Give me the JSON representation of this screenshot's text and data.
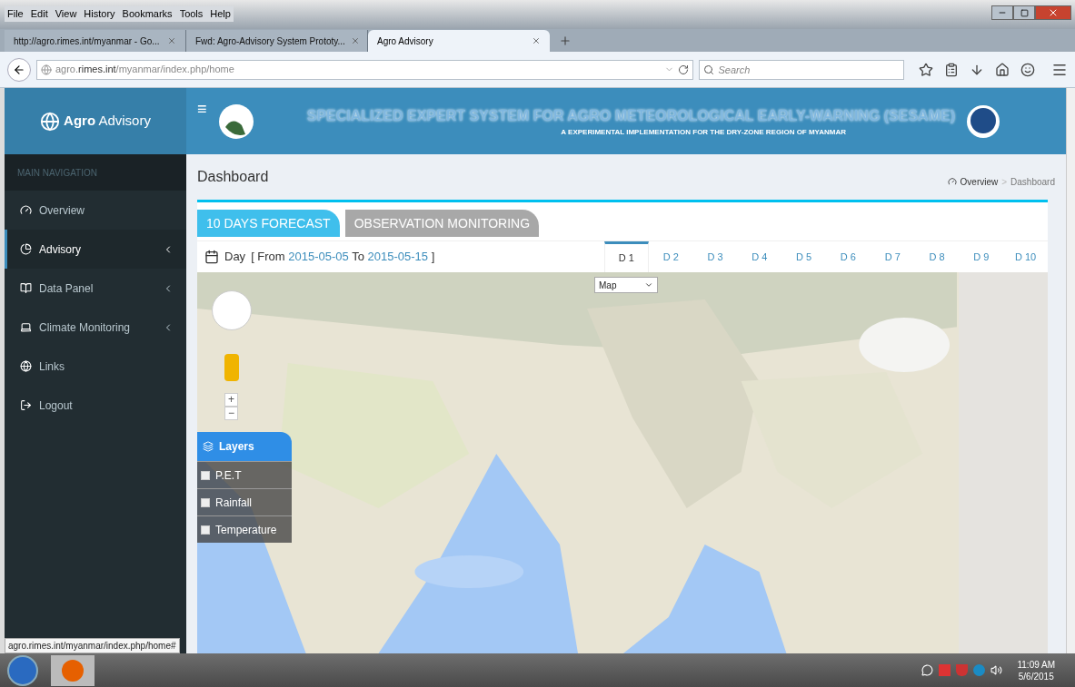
{
  "menu_bar": [
    "File",
    "Edit",
    "View",
    "History",
    "Bookmarks",
    "Tools",
    "Help"
  ],
  "browser_tabs": [
    {
      "title": "http://agro.rimes.int/myanmar - Go...",
      "selected": false
    },
    {
      "title": "Fwd: Agro-Advisory System Prototy...",
      "selected": false
    },
    {
      "title": "Agro Advisory",
      "selected": true
    }
  ],
  "address_bar": {
    "host_prefix": "agro.",
    "host": "rimes.int",
    "path": "/myanmar/index.php/home"
  },
  "search": {
    "placeholder": "Search"
  },
  "app": {
    "logo_bold": "Agro",
    "logo_text": "Advisory",
    "menu_toggle": "≡",
    "banner_title": "SPECIALIZED EXPERT SYSTEM FOR AGRO METEOROLOGICAL EARLY-WARNING (SESAME)",
    "banner_subtitle": "A EXPERIMENTAL IMPLEMENTATION FOR THE DRY-ZONE REGION OF MYANMAR"
  },
  "sidebar": {
    "heading": "MAIN NAVIGATION",
    "items": [
      {
        "label": "Overview",
        "selected": false,
        "has_submenu": false
      },
      {
        "label": "Advisory",
        "selected": true,
        "has_submenu": true
      },
      {
        "label": "Data Panel",
        "selected": false,
        "has_submenu": true
      },
      {
        "label": "Climate Monitoring",
        "selected": false,
        "has_submenu": true
      },
      {
        "label": "Links",
        "selected": false,
        "has_submenu": false
      },
      {
        "label": "Logout",
        "selected": false,
        "has_submenu": false
      }
    ]
  },
  "page_title": "Dashboard",
  "breadcrumb": [
    "Overview",
    "Dashboard"
  ],
  "breadcrumb_separator": ">",
  "section_tabs": [
    {
      "label": "10 DAYS FORECAST",
      "selected": true
    },
    {
      "label": "OBSERVATION MONITORING",
      "selected": false
    }
  ],
  "day_range": {
    "label": "Day",
    "open": "[ From",
    "from": "2015-05-05",
    "to_label": "To",
    "to": "2015-05-15",
    "close": "]"
  },
  "day_tabs": [
    {
      "label": "D 1",
      "selected": true
    },
    {
      "label": "D 2",
      "selected": false
    },
    {
      "label": "D 3",
      "selected": false
    },
    {
      "label": "D 4",
      "selected": false
    },
    {
      "label": "D 5",
      "selected": false
    },
    {
      "label": "D 6",
      "selected": false
    },
    {
      "label": "D 7",
      "selected": false
    },
    {
      "label": "D 8",
      "selected": false
    },
    {
      "label": "D 9",
      "selected": false
    },
    {
      "label": "D 10",
      "selected": false
    }
  ],
  "map": {
    "type_select": "Map",
    "zoom_in": "+",
    "zoom_out": "−",
    "layers_title": "Layers",
    "layers": [
      {
        "label": "P.E.T",
        "checked": false
      },
      {
        "label": "Rainfall",
        "checked": false
      },
      {
        "label": "Temperature",
        "checked": false
      }
    ]
  },
  "status_url": "agro.rimes.int/myanmar/index.php/home#",
  "taskbar": {
    "time": "11:09 AM",
    "date": "5/6/2015"
  }
}
